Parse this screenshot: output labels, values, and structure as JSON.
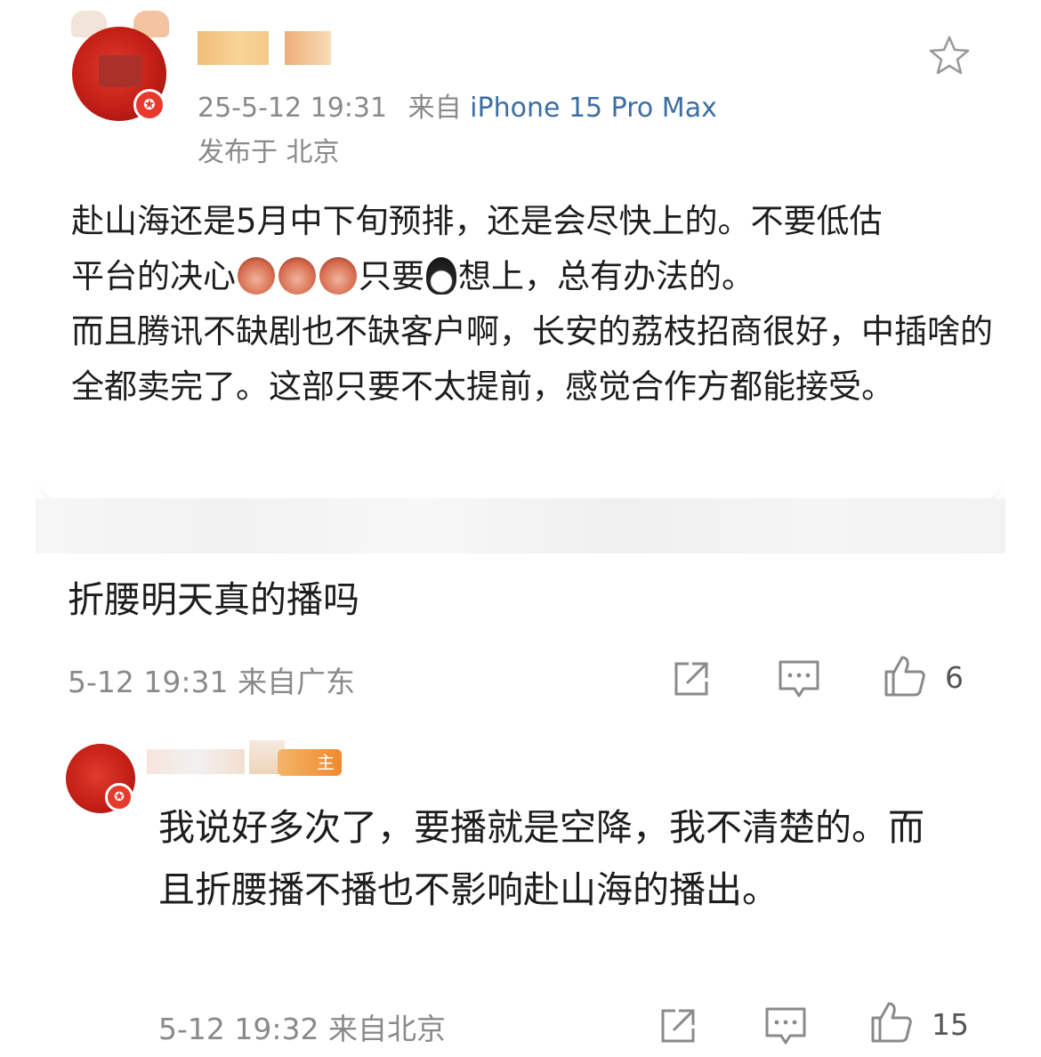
{
  "post": {
    "avatar_badge": "✪",
    "timestamp": "25-5-12 19:31",
    "source_prefix": "来自",
    "device": "iPhone 15 Pro Max",
    "location": "发布于 北京",
    "text_line1": "赴山海还是5月中下旬预排，还是会尽快上的。不要低估",
    "text_line2_a": "平台的决心",
    "text_line2_b": "只要",
    "text_line2_c": "想上，总有办法的。",
    "text_para2": "而且腾讯不缺剧也不缺客户啊，长安的荔枝招商很好，中插啥的全都卖完了。这部只要不太提前，感觉合作方都能接受。",
    "icons": {
      "favorite": "star-icon",
      "emoji_face": "emoji-face-icon",
      "emoji_penguin": "penguin-emoji-icon"
    }
  },
  "comment": {
    "text": "折腰明天真的播吗",
    "meta": "5-12 19:31 来自广东",
    "like_count": "6",
    "icons": [
      "share-icon",
      "comment-icon",
      "like-icon"
    ]
  },
  "reply": {
    "author_badge": "主",
    "avatar_badge": "✪",
    "text": "我说好多次了，要播就是空降，我不清楚的。而且折腰播不播也不影响赴山海的播出。",
    "meta": "5-12 19:32 来自北京",
    "like_count": "15",
    "icons": [
      "share-icon",
      "comment-icon",
      "like-icon"
    ]
  }
}
